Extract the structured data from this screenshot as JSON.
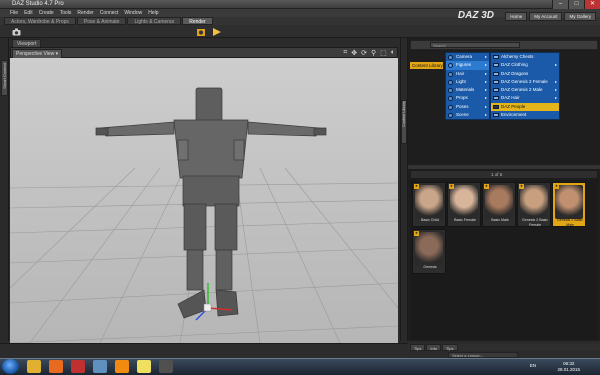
{
  "window": {
    "title": "DAZ Studio 4.7 Pro",
    "minimize": "–",
    "maximize": "□",
    "close": "✕"
  },
  "menu": [
    "File",
    "Edit",
    "Create",
    "Tools",
    "Render",
    "Connect",
    "Window",
    "Help"
  ],
  "top_tabs": [
    "Actors, Wardrobe & Props",
    "Pose & Animate",
    "Lights & Cameras",
    "Render"
  ],
  "brand": "DAZ 3D",
  "account_buttons": [
    "Home",
    "My Account",
    "My Gallery"
  ],
  "viewport": {
    "tab": "Viewport",
    "view_select": "Perspective View ▾"
  },
  "left_panel_tab": "Smart Content",
  "mid_panel_tab": "Content Library",
  "library": {
    "search_placeholder": "Search",
    "tag": "Content Library",
    "categories": [
      {
        "label": "Camera",
        "arrow": "▸"
      },
      {
        "label": "Figures",
        "arrow": "▸",
        "selected": true
      },
      {
        "label": "Hair",
        "arrow": "▸"
      },
      {
        "label": "Light",
        "arrow": "▸"
      },
      {
        "label": "Materials",
        "arrow": "▸"
      },
      {
        "label": "Props",
        "arrow": "▸"
      },
      {
        "label": "Poses",
        "arrow": "▸"
      },
      {
        "label": "Scene",
        "arrow": "▸"
      }
    ],
    "subcategories": [
      {
        "label": "Alchemy Chests",
        "arrow": ""
      },
      {
        "label": "DAZ Clothing",
        "arrow": "▸"
      },
      {
        "label": "DAZ Dragons",
        "arrow": ""
      },
      {
        "label": "DAZ Genesis 2 Female",
        "arrow": "▸"
      },
      {
        "label": "DAZ Genesis 2 Male",
        "arrow": "▸"
      },
      {
        "label": "DAZ Hair",
        "arrow": "▸"
      },
      {
        "label": "DAZ People",
        "arrow": "",
        "highlight": true
      },
      {
        "label": "Environment",
        "arrow": ""
      }
    ],
    "pager": "1 of 6",
    "thumbnails": [
      {
        "label": "Basic Child",
        "color": "#c9a58a"
      },
      {
        "label": "Basic Female",
        "color": "#d8b49a"
      },
      {
        "label": "Basic Male",
        "color": "#a87a5e"
      },
      {
        "label": "Genesis 2 Basic Female",
        "color": "#c8a080"
      },
      {
        "label": "Genesis 2 Basic Male",
        "color": "#c09070",
        "selected": true
      },
      {
        "label": "Genesis",
        "color": "#8a6a58"
      }
    ],
    "bottom_tabs": [
      "Tips",
      "Info",
      "Tips"
    ],
    "lesson_select": "Select a Lesson..."
  },
  "taskbar": {
    "time": "06:32",
    "date": "28.01.2015",
    "tray_label": "EN",
    "apps": [
      {
        "name": "explorer",
        "color": "#e0b030"
      },
      {
        "name": "firefox",
        "color": "#e86a20"
      },
      {
        "name": "media",
        "color": "#c03030"
      },
      {
        "name": "files",
        "color": "#6090c0"
      },
      {
        "name": "vlc",
        "color": "#f08a10"
      },
      {
        "name": "notes",
        "color": "#f0e060"
      },
      {
        "name": "daz",
        "color": "#505050"
      }
    ]
  }
}
